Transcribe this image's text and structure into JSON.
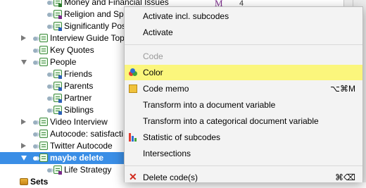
{
  "tree": {
    "rows": [
      {
        "label": "Money and Financial Issues",
        "depth": 2,
        "color": "#2c7a2c",
        "cut": true
      },
      {
        "label": "Religion and Spi",
        "depth": 2,
        "color": "#7a2a8a"
      },
      {
        "label": "Significantly Pos",
        "depth": 2,
        "color": "#2b5fb5"
      },
      {
        "label": "Interview Guide Topi",
        "depth": 1,
        "toggle": "right"
      },
      {
        "label": "Key Quotes",
        "depth": 1,
        "toggle": "none"
      },
      {
        "label": "People",
        "depth": 1,
        "toggle": "down"
      },
      {
        "label": "Friends",
        "depth": 2,
        "color": "#2b5fb5"
      },
      {
        "label": "Parents",
        "depth": 2,
        "color": "#2b5fb5"
      },
      {
        "label": "Partner",
        "depth": 2,
        "color": "#2b5fb5"
      },
      {
        "label": "Siblings",
        "depth": 2,
        "color": "#2b5fb5"
      },
      {
        "label": "Video Interview",
        "depth": 1,
        "toggle": "right"
      },
      {
        "label": "Autocode: satisfacti",
        "depth": 1,
        "toggle": "none"
      },
      {
        "label": "Twitter Autocode",
        "depth": 1,
        "toggle": "right"
      },
      {
        "label": "maybe delete",
        "depth": 1,
        "toggle": "down",
        "selected": true
      },
      {
        "label": "Life Strategy",
        "depth": 2,
        "color": "#7a2a8a"
      }
    ],
    "sets_label": "Sets",
    "memo_char": "M",
    "count_char": "4"
  },
  "menu": {
    "items": [
      {
        "type": "item",
        "label": "Activate incl. subcodes",
        "name": "menu-activate-incl-subcodes"
      },
      {
        "type": "item",
        "label": "Activate",
        "name": "menu-activate"
      },
      {
        "type": "sep"
      },
      {
        "type": "item",
        "label": "Code",
        "name": "menu-code",
        "disabled": true
      },
      {
        "type": "item",
        "label": "Color",
        "name": "menu-color",
        "icon": "color-palette-icon",
        "highlight": true
      },
      {
        "type": "item",
        "label": "Code memo",
        "name": "menu-code-memo",
        "icon": "memo-icon",
        "shortcut": "⌥⌘M"
      },
      {
        "type": "item",
        "label": "Transform into a document variable",
        "name": "menu-transform-document-variable"
      },
      {
        "type": "item",
        "label": "Transform into a categorical document variable",
        "name": "menu-transform-categorical-variable"
      },
      {
        "type": "item",
        "label": "Statistic of subcodes",
        "name": "menu-statistic-subcodes",
        "icon": "bar-chart-icon"
      },
      {
        "type": "item",
        "label": "Intersections",
        "name": "menu-intersections"
      },
      {
        "type": "sep"
      },
      {
        "type": "item",
        "label": "Delete code(s)",
        "name": "menu-delete-codes",
        "icon": "delete-x-icon",
        "shortcut": "⌘⌫"
      }
    ],
    "colors": {
      "highlight": "#fbf67c",
      "delete": "#d12a1d",
      "selection": "#3a8ee6"
    }
  }
}
